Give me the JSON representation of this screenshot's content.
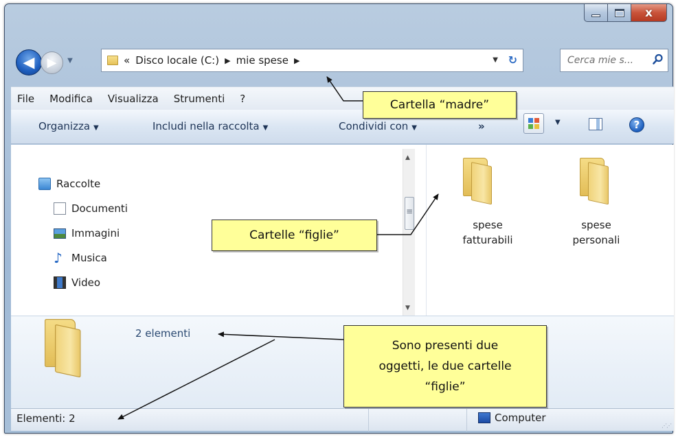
{
  "window": {
    "caption_buttons": {
      "minimize": "minimize",
      "maximize": "maximize",
      "close": "x"
    }
  },
  "address_bar": {
    "overflow": "«",
    "crumbs": [
      "Disco locale (C:)",
      "mie spese"
    ]
  },
  "search": {
    "placeholder": "Cerca mie s..."
  },
  "menu": {
    "items": [
      "File",
      "Modifica",
      "Visualizza",
      "Strumenti",
      "?"
    ]
  },
  "commands": {
    "organize": "Organizza",
    "include": "Includi nella raccolta",
    "share": "Condividi con",
    "more": "»"
  },
  "nav_pane": {
    "libraries": "Raccolte",
    "items": [
      "Documenti",
      "Immagini",
      "Musica",
      "Video"
    ]
  },
  "folders": [
    {
      "line1": "spese",
      "line2": "fatturabili"
    },
    {
      "line1": "spese",
      "line2": "personali"
    }
  ],
  "details": {
    "count": "2 elementi"
  },
  "status": {
    "items": "Elementi: 2",
    "location": "Computer"
  },
  "annotations": {
    "parent": "Cartella “madre”",
    "children": "Cartelle “figlie”",
    "objects_line1": "Sono presenti due",
    "objects_line2": "oggetti, le due cartelle",
    "objects_line3": "“figlie”"
  },
  "colors": {
    "callout_bg": "#ffff99",
    "accent": "#1f5fbf"
  }
}
